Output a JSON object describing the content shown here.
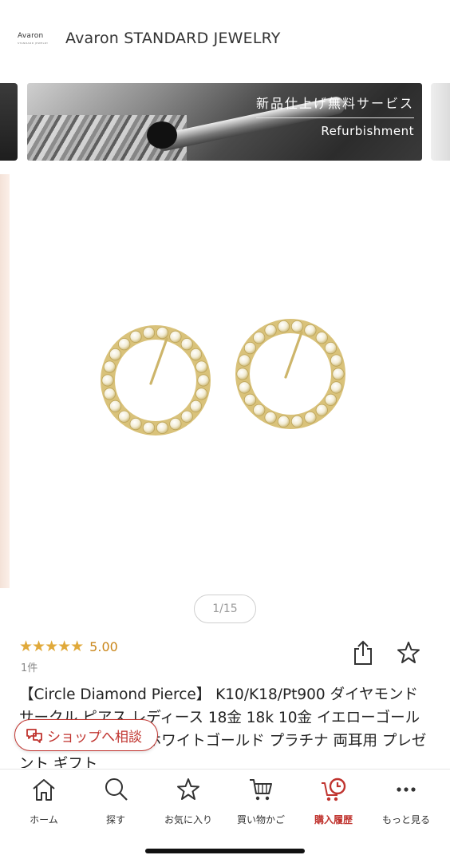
{
  "header": {
    "logo_text": "Avaron",
    "logo_sub": "STANDARD JEWELRY",
    "shop_name": "Avaron STANDARD JEWELRY"
  },
  "banner": {
    "title_jp": "新品仕上げ無料サービス",
    "subtitle_en": "Refurbishment"
  },
  "gallery": {
    "current": 1,
    "total": 15,
    "indicator": "1/15"
  },
  "rating": {
    "stars": "★★★★★",
    "value": "5.00",
    "count_label": "1件"
  },
  "product": {
    "title": "【Circle Diamond Pierce】 K10/K18/Pt900 ダイヤモンド サークル ピアス レディース 18金 18k 10金 イエローゴールド ピンクゴールド ホワイトゴールド プラチナ 両耳用 プレゼント ギフト"
  },
  "consult_button": {
    "label": "ショップへ相談"
  },
  "bottom_nav": {
    "items": [
      {
        "label": "ホーム",
        "icon": "home-icon"
      },
      {
        "label": "探す",
        "icon": "search-icon"
      },
      {
        "label": "お気に入り",
        "icon": "star-icon"
      },
      {
        "label": "買い物かご",
        "icon": "cart-icon"
      },
      {
        "label": "購入履歴",
        "icon": "history-cart-icon"
      },
      {
        "label": "もっと見る",
        "icon": "more-icon"
      }
    ],
    "active_index": 4
  },
  "colors": {
    "accent": "#c0342f",
    "star": "#e0a93a",
    "gold": "#d9c27a"
  }
}
